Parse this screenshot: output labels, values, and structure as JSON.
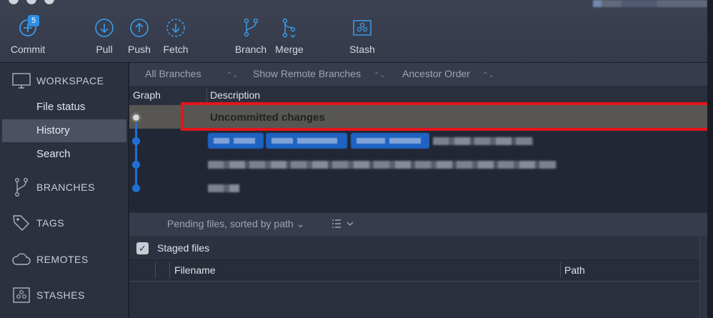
{
  "toolbar": {
    "commit": {
      "label": "Commit",
      "badge": "5"
    },
    "pull": "Pull",
    "push": "Push",
    "fetch": "Fetch",
    "branch": "Branch",
    "merge": "Merge",
    "stash": "Stash"
  },
  "sidebar": {
    "workspace": "WORKSPACE",
    "items": [
      "File status",
      "History",
      "Search"
    ],
    "active_item": "History",
    "branches": "BRANCHES",
    "tags": "TAGS",
    "remotes": "REMOTES",
    "stashes": "STASHES"
  },
  "filters": {
    "branches": "All Branches",
    "remote": "Show Remote Branches",
    "order": "Ancestor Order"
  },
  "graph": {
    "col_graph": "Graph",
    "col_description": "Description",
    "uncommitted": "Uncommitted changes"
  },
  "pending": {
    "label": "Pending files, sorted by path"
  },
  "staged": {
    "label": "Staged files",
    "checked": true,
    "col_filename": "Filename",
    "col_path": "Path"
  },
  "colors": {
    "accent": "#1f6fd4",
    "highlight": "#e2151a"
  }
}
